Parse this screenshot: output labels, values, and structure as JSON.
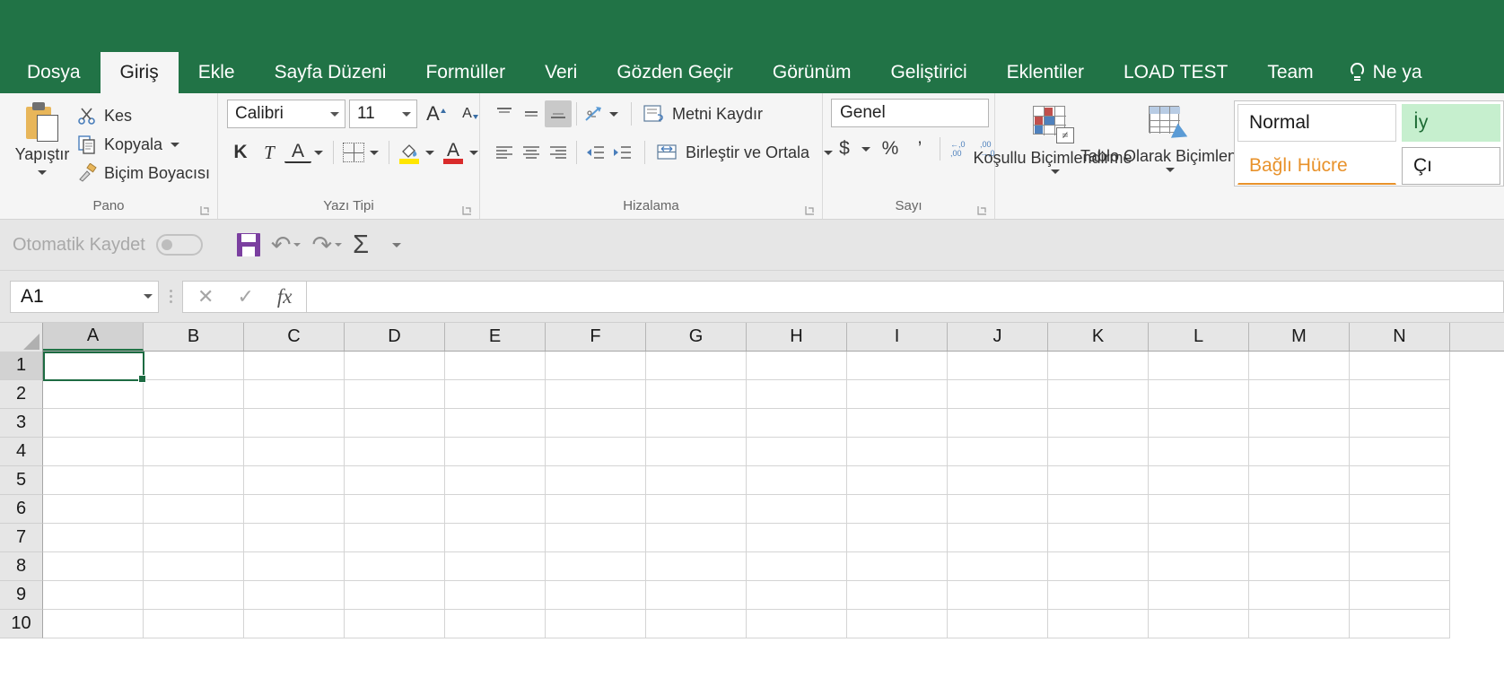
{
  "app": {
    "theme_green": "#217346",
    "selected_cell_color": "#1d6b42"
  },
  "tabs": [
    {
      "label": "Dosya",
      "active": false
    },
    {
      "label": "Giriş",
      "active": true
    },
    {
      "label": "Ekle",
      "active": false
    },
    {
      "label": "Sayfa Düzeni",
      "active": false
    },
    {
      "label": "Formüller",
      "active": false
    },
    {
      "label": "Veri",
      "active": false
    },
    {
      "label": "Gözden Geçir",
      "active": false
    },
    {
      "label": "Görünüm",
      "active": false
    },
    {
      "label": "Geliştirici",
      "active": false
    },
    {
      "label": "Eklentiler",
      "active": false
    },
    {
      "label": "LOAD TEST",
      "active": false
    },
    {
      "label": "Team",
      "active": false
    }
  ],
  "tell_me": {
    "label": "Ne ya",
    "icon": "lightbulb-icon"
  },
  "ribbon": {
    "clipboard": {
      "group_label": "Pano",
      "paste_label": "Yapıştır",
      "items": [
        {
          "label": "Kes",
          "icon": "scissors-icon",
          "has_caret": false
        },
        {
          "label": "Kopyala",
          "icon": "copy-icon",
          "has_caret": true
        },
        {
          "label": "Biçim Boyacısı",
          "icon": "format-painter-icon",
          "has_caret": false
        }
      ]
    },
    "font": {
      "group_label": "Yazı Tipi",
      "font_name": "Calibri",
      "font_size": "11",
      "grow_font": "A",
      "shrink_font": "A",
      "bold": "K",
      "italic": "T",
      "underline": "A",
      "fill_color_label": "A",
      "font_color_label": "A"
    },
    "alignment": {
      "group_label": "Hizalama",
      "wrap_text": "Metni Kaydır",
      "merge_center": "Birleştir ve Ortala"
    },
    "number": {
      "group_label": "Sayı",
      "format": "Genel",
      "currency": "$",
      "percent": "%",
      "comma": "’",
      "increase_decimal": "←,0 ,00",
      "decrease_decimal": ",00 →,0"
    },
    "styles": {
      "conditional_formatting": "Koşullu Biçimlendirme",
      "format_as_table": "Tablo Olarak Biçimlendir",
      "gallery": [
        {
          "label": "Normal",
          "kind": "normal"
        },
        {
          "label": "İy",
          "kind": "good"
        },
        {
          "label": "Bağlı Hücre",
          "kind": "linked"
        },
        {
          "label": "Çı",
          "kind": "output"
        }
      ]
    }
  },
  "quick_access": {
    "autosave_label": "Otomatik Kaydet",
    "autosave_state": "off",
    "save_icon": "save-icon",
    "undo_icon": "undo-icon",
    "redo_icon": "redo-icon",
    "autosum_icon": "sigma-icon",
    "autosum_glyph": "Σ",
    "undo_glyph": "↶",
    "redo_glyph": "↷"
  },
  "formula_bar": {
    "name_box": "A1",
    "cancel_glyph": "✕",
    "enter_glyph": "✓",
    "fx_glyph": "fx",
    "formula_value": ""
  },
  "grid": {
    "columns": [
      "A",
      "B",
      "C",
      "D",
      "E",
      "F",
      "G",
      "H",
      "I",
      "J",
      "K",
      "L",
      "M",
      "N"
    ],
    "rows": [
      "1",
      "2",
      "3",
      "4",
      "5",
      "6",
      "7",
      "8",
      "9",
      "10"
    ],
    "selected_cell": "A1",
    "selected_column": "A",
    "selected_row": "1"
  }
}
